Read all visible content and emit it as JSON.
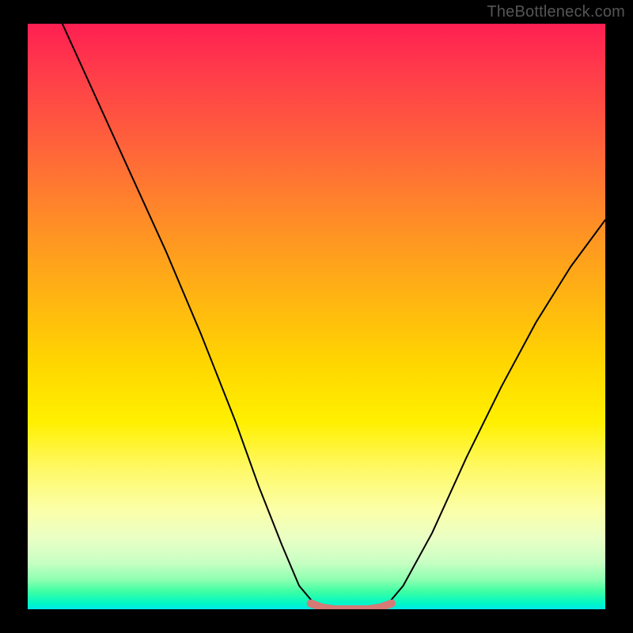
{
  "watermark": "TheBottleneck.com",
  "colors": {
    "frame_bg": "#000000",
    "curve": "#000000",
    "flat_highlight": "#d57a74",
    "gradient_top": "#ff1f52",
    "gradient_bottom": "#00e6e6"
  },
  "chart_data": {
    "type": "line",
    "title": "",
    "xlabel": "",
    "ylabel": "",
    "xlim": [
      0,
      1
    ],
    "ylim": [
      0,
      1
    ],
    "note": "Bottleneck curve on a red-to-green background. x is normalized horizontal position across the gradient area (0=left, 1=right). y is normalized height from bottom (0=bottom/green, 1=top/red). The V-shaped curve reaches 0 at the flat region; the flat_region series is the pink highlighted segment near the bottom.",
    "series": [
      {
        "name": "curve",
        "x": [
          0.06,
          0.12,
          0.18,
          0.24,
          0.3,
          0.36,
          0.4,
          0.44,
          0.47,
          0.5,
          0.53,
          0.56,
          0.59,
          0.62,
          0.65,
          0.7,
          0.76,
          0.82,
          0.88,
          0.94,
          1.0
        ],
        "y": [
          1.0,
          0.87,
          0.74,
          0.61,
          0.47,
          0.32,
          0.21,
          0.11,
          0.04,
          0.005,
          0.0,
          0.0,
          0.0,
          0.005,
          0.04,
          0.13,
          0.26,
          0.38,
          0.49,
          0.585,
          0.665
        ]
      },
      {
        "name": "flat_region",
        "x": [
          0.49,
          0.51,
          0.53,
          0.55,
          0.57,
          0.59,
          0.61,
          0.63
        ],
        "y": [
          0.01,
          0.003,
          0.0,
          0.0,
          0.0,
          0.0,
          0.003,
          0.01
        ]
      }
    ]
  }
}
